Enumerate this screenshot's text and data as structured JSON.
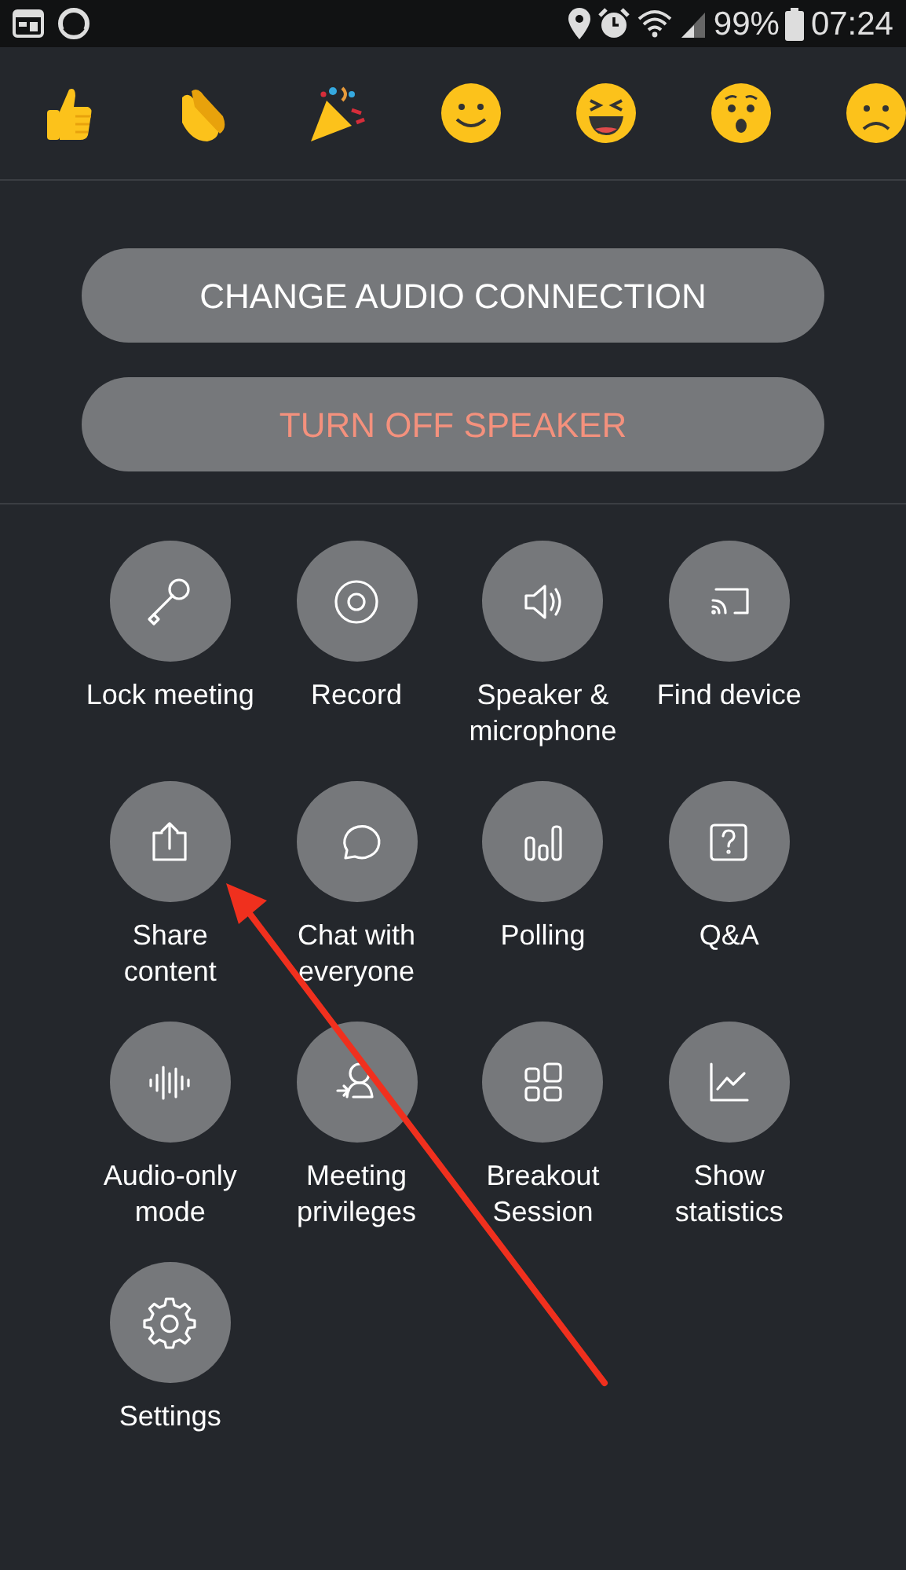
{
  "status_bar": {
    "battery": "99%",
    "time": "07:24"
  },
  "audio_buttons": [
    {
      "label": "CHANGE AUDIO CONNECTION",
      "kind": "default"
    },
    {
      "label": "TURN OFF SPEAKER",
      "kind": "warning"
    }
  ],
  "actions": [
    {
      "label": "Lock meeting",
      "kind": "key"
    },
    {
      "label": "Record",
      "kind": "record"
    },
    {
      "label": "Speaker &\nmicrophone",
      "kind": "speaker"
    },
    {
      "label": "Find device",
      "kind": "cast"
    },
    {
      "label": "Share\ncontent",
      "kind": "share"
    },
    {
      "label": "Chat with\neveryone",
      "kind": "chat"
    },
    {
      "label": "Polling",
      "kind": "polling"
    },
    {
      "label": "Q&A",
      "kind": "qa"
    },
    {
      "label": "Audio-only\nmode",
      "kind": "audio"
    },
    {
      "label": "Meeting\nprivileges",
      "kind": "privileges"
    },
    {
      "label": "Breakout\nSession",
      "kind": "breakout"
    },
    {
      "label": "Show\nstatistics",
      "kind": "stats"
    },
    {
      "label": "Settings",
      "kind": "settings"
    }
  ]
}
